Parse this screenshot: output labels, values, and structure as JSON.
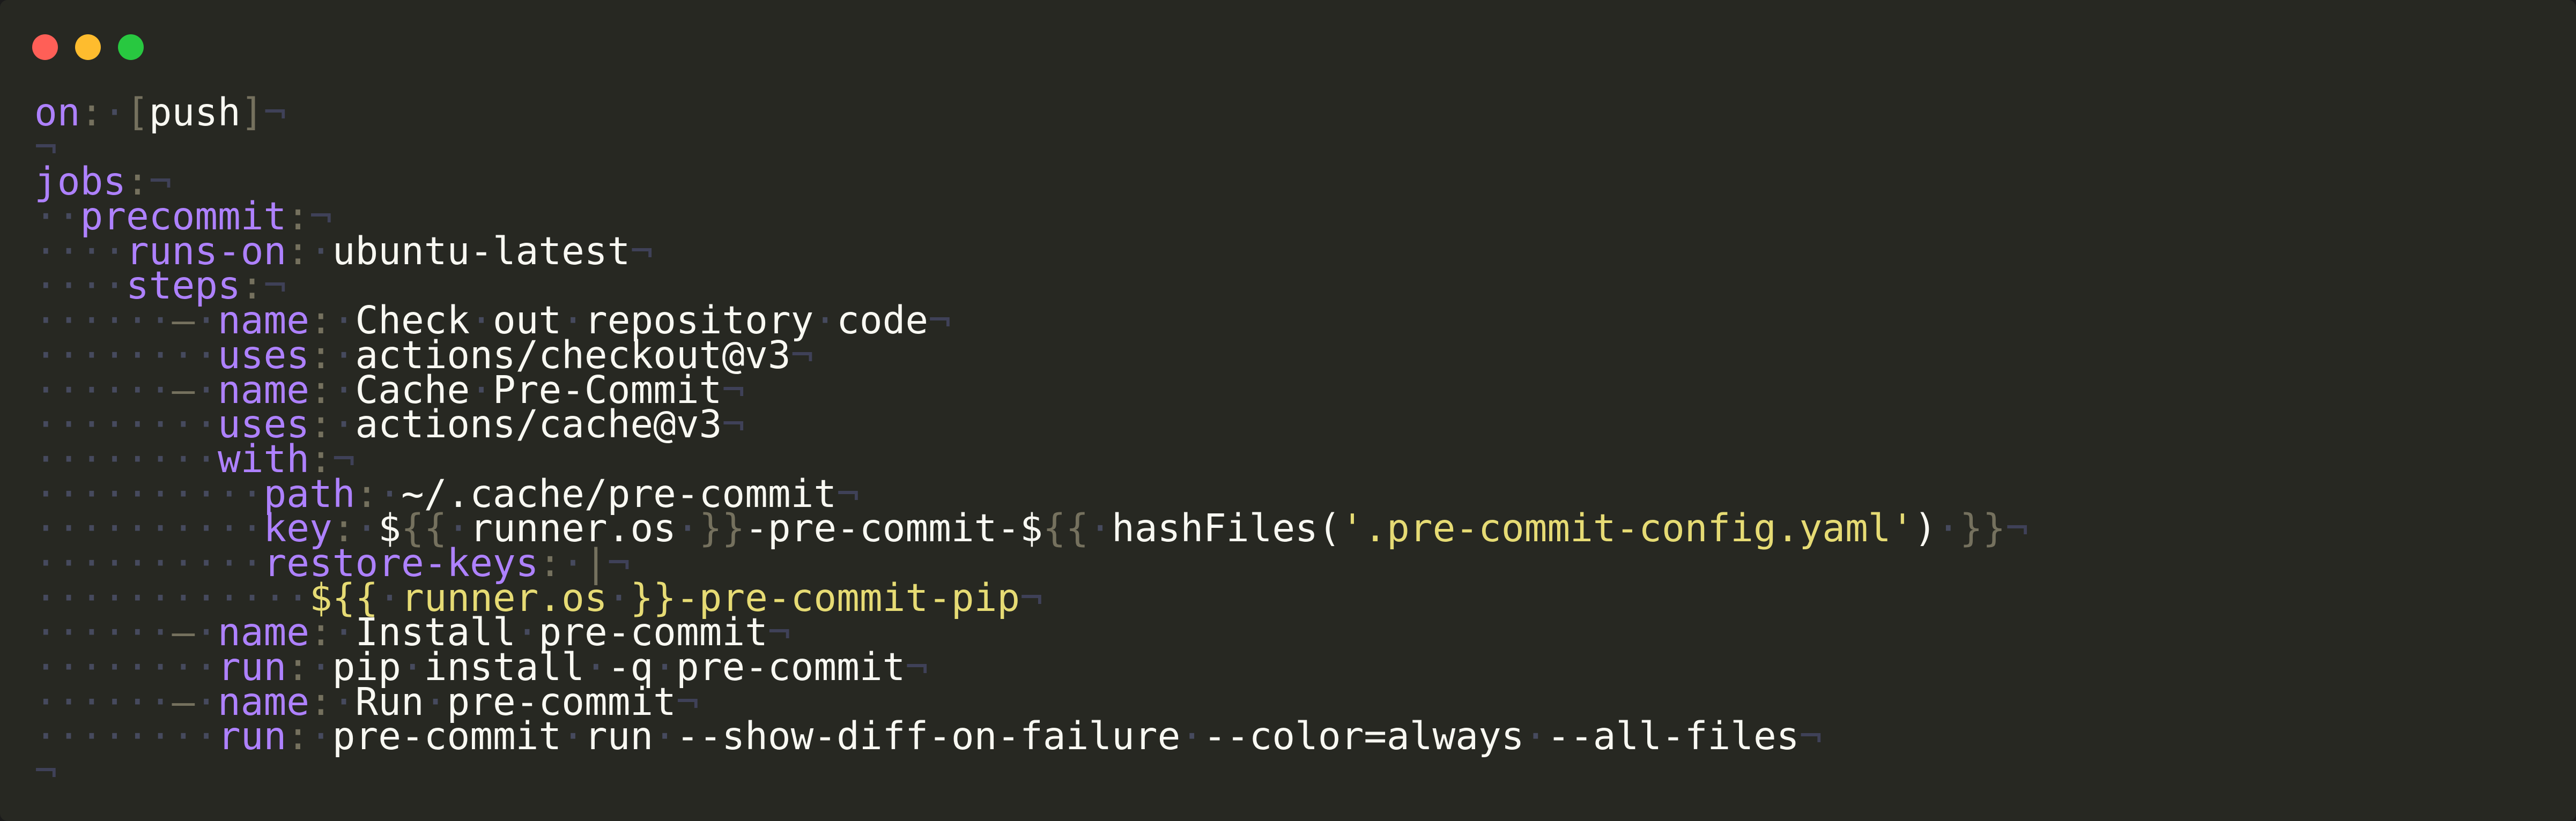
{
  "colors": {
    "background": "#272822",
    "key": "#ae81ff",
    "value": "#f8f8f2",
    "string": "#e6db74",
    "punctuation": "#75715e",
    "whitespace": "#464a5e",
    "close": "#ff5f57",
    "minimize": "#febc2e",
    "maximize": "#28c840"
  },
  "window_controls": [
    "close-icon",
    "minimize-icon",
    "maximize-icon"
  ],
  "code": {
    "lines": [
      [
        [
          "k",
          "on"
        ],
        [
          "p",
          ":"
        ],
        [
          "sp",
          "·"
        ],
        [
          "p",
          "["
        ],
        [
          "v",
          "push"
        ],
        [
          "p",
          "]"
        ],
        [
          "e",
          "¬"
        ]
      ],
      [
        [
          "e",
          "¬"
        ]
      ],
      [
        [
          "k",
          "jobs"
        ],
        [
          "p",
          ":"
        ],
        [
          "e",
          "¬"
        ]
      ],
      [
        [
          "sp",
          "··"
        ],
        [
          "k",
          "precommit"
        ],
        [
          "p",
          ":"
        ],
        [
          "e",
          "¬"
        ]
      ],
      [
        [
          "sp",
          "····"
        ],
        [
          "k",
          "runs-on"
        ],
        [
          "p",
          ":"
        ],
        [
          "sp",
          "·"
        ],
        [
          "v",
          "ubuntu-latest"
        ],
        [
          "e",
          "¬"
        ]
      ],
      [
        [
          "sp",
          "····"
        ],
        [
          "k",
          "steps"
        ],
        [
          "p",
          ":"
        ],
        [
          "e",
          "¬"
        ]
      ],
      [
        [
          "sp",
          "······"
        ],
        [
          "d",
          "–"
        ],
        [
          "sp",
          "·"
        ],
        [
          "k",
          "name"
        ],
        [
          "p",
          ":"
        ],
        [
          "sp",
          "·"
        ],
        [
          "v",
          "Check"
        ],
        [
          "sp",
          "·"
        ],
        [
          "v",
          "out"
        ],
        [
          "sp",
          "·"
        ],
        [
          "v",
          "repository"
        ],
        [
          "sp",
          "·"
        ],
        [
          "v",
          "code"
        ],
        [
          "e",
          "¬"
        ]
      ],
      [
        [
          "sp",
          "········"
        ],
        [
          "k",
          "uses"
        ],
        [
          "p",
          ":"
        ],
        [
          "sp",
          "·"
        ],
        [
          "v",
          "actions/checkout@v3"
        ],
        [
          "e",
          "¬"
        ]
      ],
      [
        [
          "sp",
          "······"
        ],
        [
          "d",
          "–"
        ],
        [
          "sp",
          "·"
        ],
        [
          "k",
          "name"
        ],
        [
          "p",
          ":"
        ],
        [
          "sp",
          "·"
        ],
        [
          "v",
          "Cache"
        ],
        [
          "sp",
          "·"
        ],
        [
          "v",
          "Pre-Commit"
        ],
        [
          "e",
          "¬"
        ]
      ],
      [
        [
          "sp",
          "········"
        ],
        [
          "k",
          "uses"
        ],
        [
          "p",
          ":"
        ],
        [
          "sp",
          "·"
        ],
        [
          "v",
          "actions/cache@v3"
        ],
        [
          "e",
          "¬"
        ]
      ],
      [
        [
          "sp",
          "········"
        ],
        [
          "k",
          "with"
        ],
        [
          "p",
          ":"
        ],
        [
          "e",
          "¬"
        ]
      ],
      [
        [
          "sp",
          "··········"
        ],
        [
          "k",
          "path"
        ],
        [
          "p",
          ":"
        ],
        [
          "sp",
          "·"
        ],
        [
          "v",
          "~/.cache/pre-commit"
        ],
        [
          "e",
          "¬"
        ]
      ],
      [
        [
          "sp",
          "··········"
        ],
        [
          "k",
          "key"
        ],
        [
          "p",
          ":"
        ],
        [
          "sp",
          "·"
        ],
        [
          "v",
          "$"
        ],
        [
          "p",
          "{{"
        ],
        [
          "sp",
          "·"
        ],
        [
          "v",
          "runner.os"
        ],
        [
          "sp",
          "·"
        ],
        [
          "p",
          "}}"
        ],
        [
          "v",
          "-pre-commit-$"
        ],
        [
          "p",
          "{{"
        ],
        [
          "sp",
          "·"
        ],
        [
          "v",
          "hashFiles("
        ],
        [
          "s",
          "'.pre-commit-config.yaml'"
        ],
        [
          "v",
          ")"
        ],
        [
          "sp",
          "·"
        ],
        [
          "p",
          "}}"
        ],
        [
          "e",
          "¬"
        ]
      ],
      [
        [
          "sp",
          "··········"
        ],
        [
          "k",
          "restore-keys"
        ],
        [
          "p",
          ":"
        ],
        [
          "sp",
          "·"
        ],
        [
          "p",
          "|"
        ],
        [
          "e",
          "¬"
        ]
      ],
      [
        [
          "sp",
          "············"
        ],
        [
          "s",
          "${{"
        ],
        [
          "sp",
          "·"
        ],
        [
          "s",
          "runner.os"
        ],
        [
          "sp",
          "·"
        ],
        [
          "s",
          "}}-pre-commit-pip"
        ],
        [
          "e",
          "¬"
        ]
      ],
      [
        [
          "sp",
          "······"
        ],
        [
          "d",
          "–"
        ],
        [
          "sp",
          "·"
        ],
        [
          "k",
          "name"
        ],
        [
          "p",
          ":"
        ],
        [
          "sp",
          "·"
        ],
        [
          "v",
          "Install"
        ],
        [
          "sp",
          "·"
        ],
        [
          "v",
          "pre-commit"
        ],
        [
          "e",
          "¬"
        ]
      ],
      [
        [
          "sp",
          "········"
        ],
        [
          "k",
          "run"
        ],
        [
          "p",
          ":"
        ],
        [
          "sp",
          "·"
        ],
        [
          "v",
          "pip"
        ],
        [
          "sp",
          "·"
        ],
        [
          "v",
          "install"
        ],
        [
          "sp",
          "·"
        ],
        [
          "v",
          "-q"
        ],
        [
          "sp",
          "·"
        ],
        [
          "v",
          "pre-commit"
        ],
        [
          "e",
          "¬"
        ]
      ],
      [
        [
          "sp",
          "······"
        ],
        [
          "d",
          "–"
        ],
        [
          "sp",
          "·"
        ],
        [
          "k",
          "name"
        ],
        [
          "p",
          ":"
        ],
        [
          "sp",
          "·"
        ],
        [
          "v",
          "Run"
        ],
        [
          "sp",
          "·"
        ],
        [
          "v",
          "pre-commit"
        ],
        [
          "e",
          "¬"
        ]
      ],
      [
        [
          "sp",
          "········"
        ],
        [
          "k",
          "run"
        ],
        [
          "p",
          ":"
        ],
        [
          "sp",
          "·"
        ],
        [
          "v",
          "pre-commit"
        ],
        [
          "sp",
          "·"
        ],
        [
          "v",
          "run"
        ],
        [
          "sp",
          "·"
        ],
        [
          "v",
          "--show-diff-on-failure"
        ],
        [
          "sp",
          "·"
        ],
        [
          "v",
          "--color=always"
        ],
        [
          "sp",
          "·"
        ],
        [
          "v",
          "--all-files"
        ],
        [
          "e",
          "¬"
        ]
      ],
      [
        [
          "e",
          "¬"
        ]
      ]
    ]
  }
}
